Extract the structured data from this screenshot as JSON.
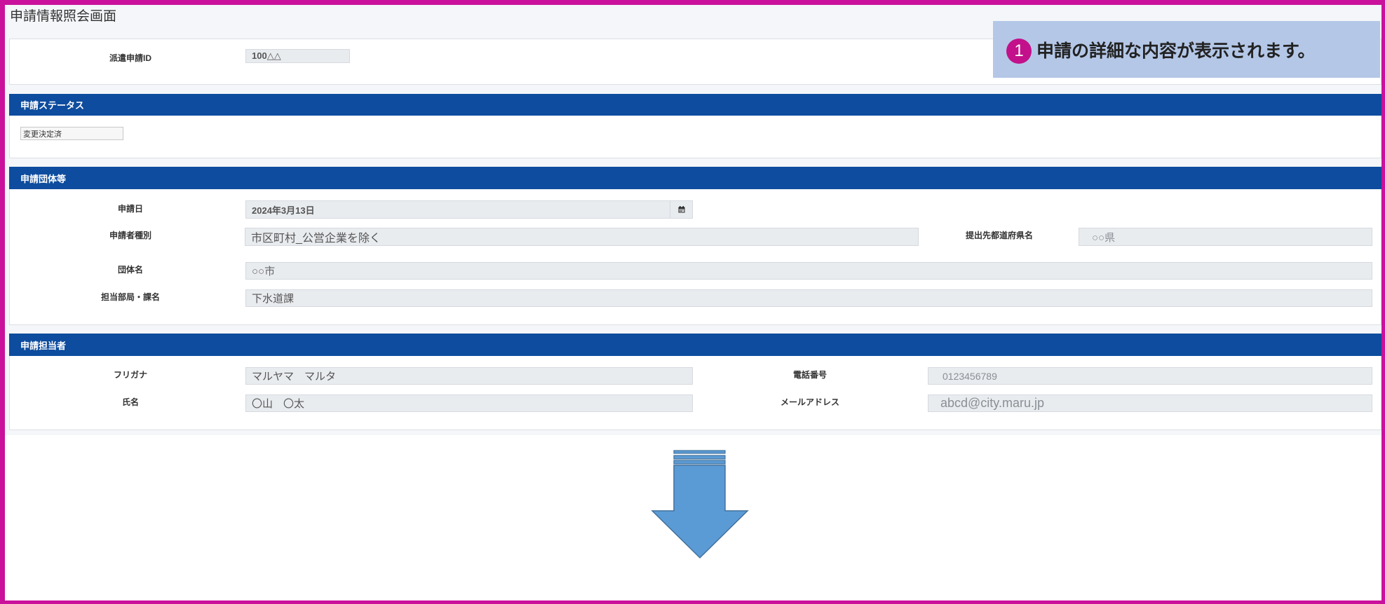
{
  "page": {
    "title": "申請情報照会画面"
  },
  "callout": {
    "badge": "1",
    "text": "申請の詳細な内容が表示されます。"
  },
  "application_id": {
    "label": "派遣申請ID",
    "value": "100△△"
  },
  "status_section": {
    "header": "申請ステータス",
    "status_value": "変更決定済"
  },
  "organization_section": {
    "header": "申請団体等",
    "application_date": {
      "label": "申請日",
      "value": "2024年3月13日"
    },
    "applicant_type": {
      "label": "申請者種別",
      "value": "市区町村_公営企業を除く"
    },
    "prefecture": {
      "label": "提出先都道府県名",
      "value": "○○県"
    },
    "organization_name": {
      "label": "団体名",
      "value": "○○市"
    },
    "department": {
      "label": "担当部局・課名",
      "value": "下水道課"
    }
  },
  "contact_section": {
    "header": "申請担当者",
    "furigana": {
      "label": "フリガナ",
      "value": "マルヤマ　マルタ"
    },
    "phone": {
      "label": "電話番号",
      "value": "0123456789"
    },
    "name": {
      "label": "氏名",
      "value": "〇山　〇太"
    },
    "email": {
      "label": "メールアドレス",
      "value": "abcd@city.maru.jp"
    }
  },
  "icons": {
    "date_picker": "calendar-icon",
    "flow_arrow": "down-arrow-icon",
    "callout_badge": "number-1-badge"
  },
  "colors": {
    "frame": "#c9119b",
    "section_header": "#0d4c9e",
    "callout_background": "#b4c7e7",
    "callout_badge": "#c2118a",
    "field_background": "#e9ecef",
    "arrow_fill": "#5b9bd5",
    "arrow_stroke": "#41719c"
  }
}
